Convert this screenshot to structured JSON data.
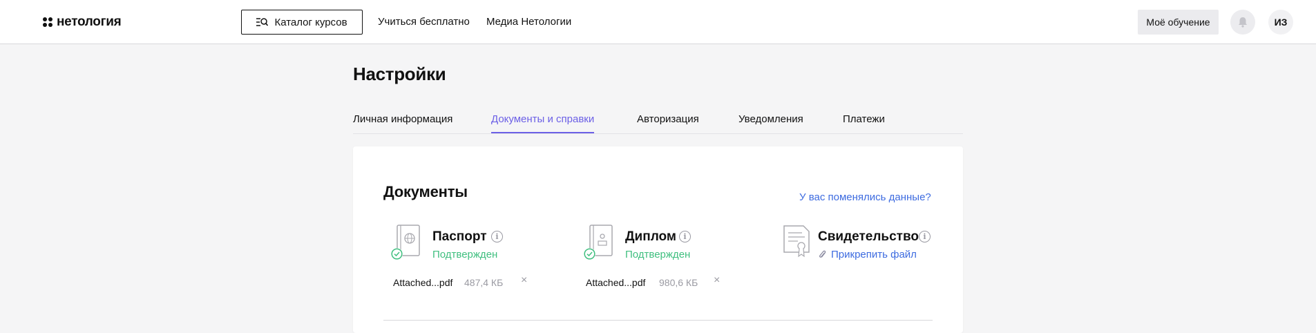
{
  "header": {
    "logo_text": "нетология",
    "catalog_label": "Каталог курсов",
    "nav": [
      "Учиться бесплатно",
      "Медиа Нетологии"
    ],
    "my_learning_label": "Моё обучение",
    "avatar_initials": "ИЗ"
  },
  "page": {
    "title": "Настройки",
    "tabs": [
      "Личная информация",
      "Документы и справки",
      "Авторизация",
      "Уведомления",
      "Платежи"
    ],
    "active_tab": "Документы и справки"
  },
  "documents": {
    "title": "Документы",
    "change_link": "У вас поменялись данные?",
    "items": [
      {
        "name": "Паспорт",
        "icon": "passport-icon",
        "status": "Подтвержден",
        "file_name": "Attached...pdf",
        "file_size": "487,4 КБ"
      },
      {
        "name": "Диплом",
        "icon": "diploma-icon",
        "status": "Подтвержден",
        "file_name": "Attached...pdf",
        "file_size": "980,6 КБ"
      },
      {
        "name": "Свидетельство",
        "icon": "certificate-icon",
        "attach_label": "Прикрепить файл"
      }
    ]
  },
  "colors": {
    "accent": "#6b5fe6",
    "link": "#3d6be0",
    "success": "#3fbf7f"
  }
}
